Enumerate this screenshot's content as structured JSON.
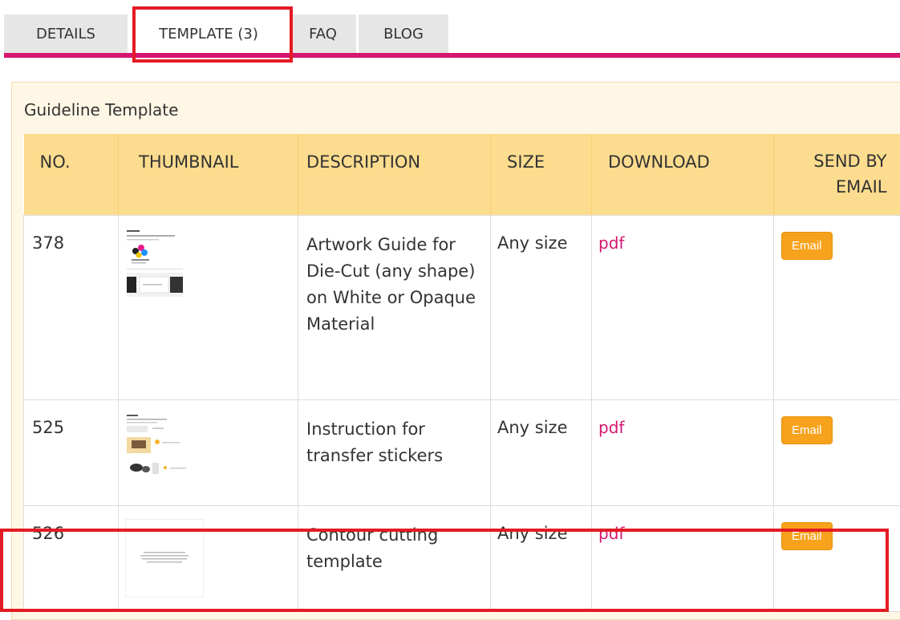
{
  "tabs": [
    {
      "label": "DETAILS"
    },
    {
      "label": "TEMPLATE (3)"
    },
    {
      "label": "FAQ"
    },
    {
      "label": "BLOG"
    }
  ],
  "panel": {
    "title": "Guideline Template"
  },
  "table": {
    "headers": {
      "no": "NO.",
      "thumbnail": "THUMBNAIL",
      "description": "DESCRIPTION",
      "size": "SIZE",
      "download": "DOWNLOAD",
      "send_by_email_line1": "SEND BY",
      "send_by_email_line2": "EMAIL"
    },
    "rows": [
      {
        "no": "378",
        "thumbnail": "guide-thumbnail",
        "description": "Artwork Guide for Die-Cut (any shape) on White or Opaque Material",
        "size": "Any size",
        "download": "pdf",
        "email": "Email"
      },
      {
        "no": "525",
        "thumbnail": "instruction-thumbnail",
        "description": "Instruction for transfer stickers",
        "size": "Any size",
        "download": "pdf",
        "email": "Email"
      },
      {
        "no": "526",
        "thumbnail": "contour-thumbnail",
        "description": "Contour cutting template",
        "size": "Any size",
        "download": "pdf",
        "email": "Email"
      }
    ]
  },
  "colors": {
    "accent": "#d6166e",
    "header_bg": "#fcdc8e",
    "panel_bg": "#fff7e5",
    "email_button": "#f7a21c",
    "highlight": "#e31b23"
  }
}
